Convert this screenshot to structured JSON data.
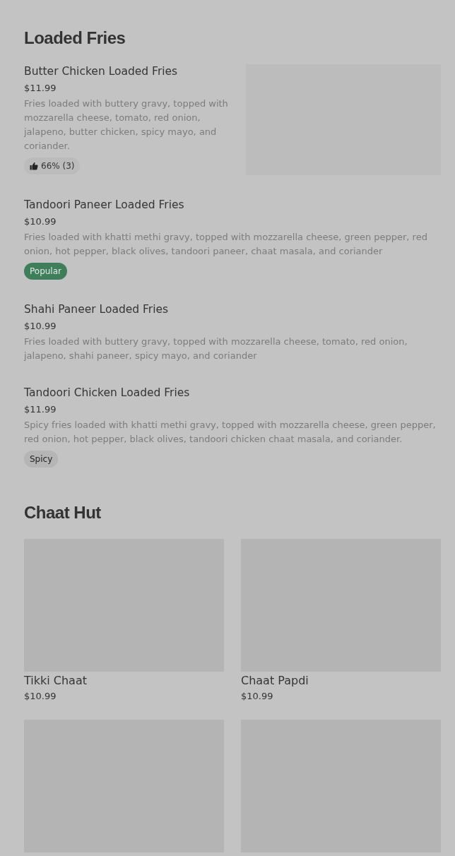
{
  "sections": [
    {
      "title": "Loaded Fries",
      "kind": "list",
      "items": [
        {
          "name": "Butter Chicken Loaded Fries",
          "price": "$11.99",
          "description": "Fries loaded with buttery gravy, topped with mozzarella cheese, tomato, red onion, jalapeno, butter chicken, spicy mayo, and coriander.",
          "image": {
            "kind": "picture"
          },
          "badge": {
            "kind": "rating",
            "text": "66% (3)"
          }
        },
        {
          "name": "Tandoori Paneer Loaded Fries",
          "price": "$10.99",
          "description": "Fries loaded with khatti methi gravy, topped with mozzarella cheese, green pepper, red onion, hot pepper, black olives, tandoori paneer, chaat masala, and coriander",
          "badge": {
            "kind": "popular",
            "text": "Popular"
          }
        },
        {
          "name": "Shahi Paneer Loaded Fries",
          "price": "$10.99",
          "description": "Fries loaded with buttery gravy, topped with mozzarella cheese, tomato, red onion, jalapeno, shahi paneer, spicy mayo, and coriander"
        },
        {
          "name": "Tandoori Chicken Loaded Fries",
          "price": "$11.99",
          "description": "Spicy fries loaded with khatti methi gravy, topped with mozzarella cheese, green pepper, red onion, hot pepper, black olives, tandoori chicken chaat masala, and coriander.",
          "badge": {
            "kind": "tag",
            "text": "Spicy"
          }
        }
      ]
    },
    {
      "title": "Chaat Hut",
      "kind": "grid",
      "items": [
        {
          "name": "Tikki Chaat",
          "price": "$10.99",
          "image": {
            "kind": "picture"
          }
        },
        {
          "name": "Chaat Papdi",
          "price": "$10.99",
          "image": {
            "kind": "picture"
          }
        },
        {
          "image": {
            "kind": "picture"
          }
        },
        {
          "image": {
            "kind": "picture"
          }
        }
      ]
    }
  ]
}
